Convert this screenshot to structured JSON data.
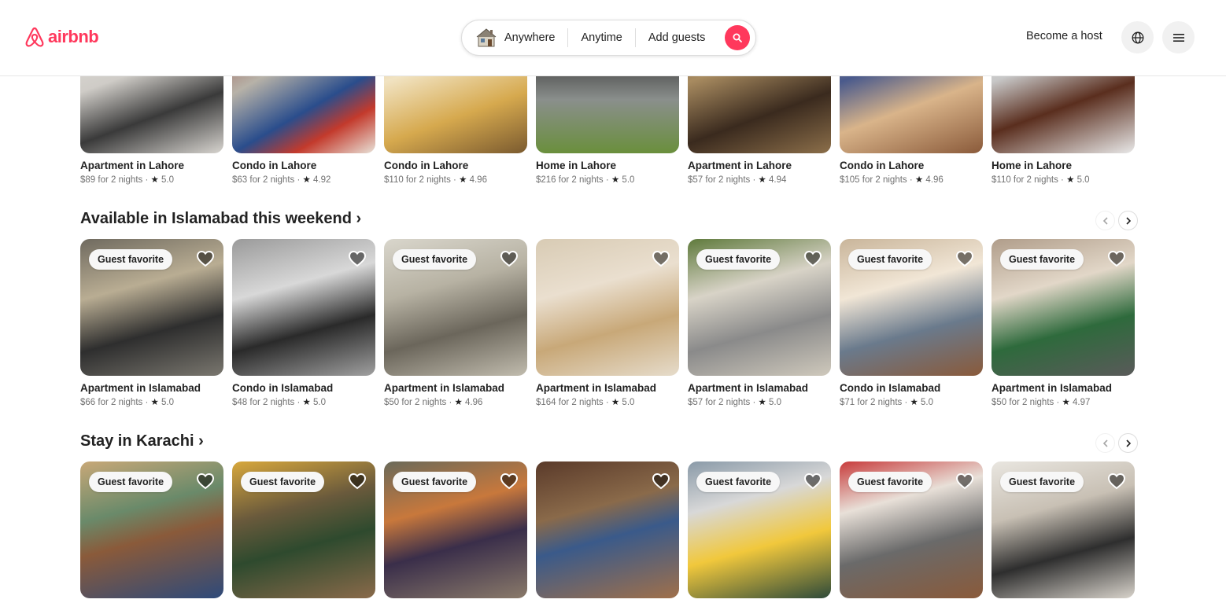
{
  "header": {
    "logo_text": "airbnb",
    "search": {
      "location": "Anywhere",
      "dates": "Anytime",
      "guests": "Add guests"
    },
    "become_host": "Become a host"
  },
  "colors": {
    "brand": "#ff385c",
    "text": "#222222",
    "muted": "#717171"
  },
  "rows": [
    {
      "title": "",
      "cards": [
        {
          "title": "Apartment in Lahore",
          "price": "$89 for 2 nights",
          "rating": "5.0",
          "guest_favorite": ""
        },
        {
          "title": "Condo in Lahore",
          "price": "$63 for 2 nights",
          "rating": "4.92",
          "guest_favorite": ""
        },
        {
          "title": "Condo in Lahore",
          "price": "$110 for 2 nights",
          "rating": "4.96",
          "guest_favorite": ""
        },
        {
          "title": "Home in Lahore",
          "price": "$216 for 2 nights",
          "rating": "5.0",
          "guest_favorite": ""
        },
        {
          "title": "Apartment in Lahore",
          "price": "$57 for 2 nights",
          "rating": "4.94",
          "guest_favorite": ""
        },
        {
          "title": "Condo in Lahore",
          "price": "$105 for 2 nights",
          "rating": "4.96",
          "guest_favorite": ""
        },
        {
          "title": "Home in Lahore",
          "price": "$110 for 2 nights",
          "rating": "5.0",
          "guest_favorite": ""
        }
      ]
    },
    {
      "title": "Available in Islamabad this weekend",
      "cards": [
        {
          "title": "Apartment in Islamabad",
          "price": "$66 for 2 nights",
          "rating": "5.0",
          "guest_favorite": "Guest favorite"
        },
        {
          "title": "Condo in Islamabad",
          "price": "$48 for 2 nights",
          "rating": "5.0",
          "guest_favorite": ""
        },
        {
          "title": "Apartment in Islamabad",
          "price": "$50 for 2 nights",
          "rating": "4.96",
          "guest_favorite": "Guest favorite"
        },
        {
          "title": "Apartment in Islamabad",
          "price": "$164 for 2 nights",
          "rating": "5.0",
          "guest_favorite": ""
        },
        {
          "title": "Apartment in Islamabad",
          "price": "$57 for 2 nights",
          "rating": "5.0",
          "guest_favorite": "Guest favorite"
        },
        {
          "title": "Condo in Islamabad",
          "price": "$71 for 2 nights",
          "rating": "5.0",
          "guest_favorite": "Guest favorite"
        },
        {
          "title": "Apartment in Islamabad",
          "price": "$50 for 2 nights",
          "rating": "4.97",
          "guest_favorite": "Guest favorite"
        }
      ]
    },
    {
      "title": "Stay in Karachi",
      "cards": [
        {
          "title": "",
          "price": "",
          "rating": "",
          "guest_favorite": "Guest favorite"
        },
        {
          "title": "",
          "price": "",
          "rating": "",
          "guest_favorite": "Guest favorite"
        },
        {
          "title": "",
          "price": "",
          "rating": "",
          "guest_favorite": "Guest favorite"
        },
        {
          "title": "",
          "price": "",
          "rating": "",
          "guest_favorite": ""
        },
        {
          "title": "",
          "price": "",
          "rating": "",
          "guest_favorite": "Guest favorite"
        },
        {
          "title": "",
          "price": "",
          "rating": "",
          "guest_favorite": "Guest favorite"
        },
        {
          "title": "",
          "price": "",
          "rating": "",
          "guest_favorite": "Guest favorite"
        }
      ]
    }
  ]
}
